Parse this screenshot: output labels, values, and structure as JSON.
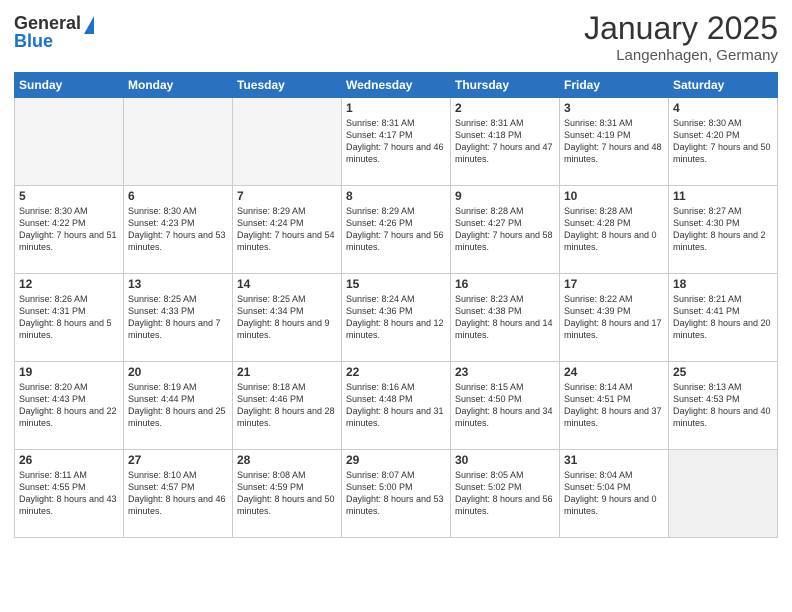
{
  "logo": {
    "general": "General",
    "blue": "Blue"
  },
  "header": {
    "month_year": "January 2025",
    "location": "Langenhagen, Germany"
  },
  "days_of_week": [
    "Sunday",
    "Monday",
    "Tuesday",
    "Wednesday",
    "Thursday",
    "Friday",
    "Saturday"
  ],
  "weeks": [
    [
      {
        "day": "",
        "info": ""
      },
      {
        "day": "",
        "info": ""
      },
      {
        "day": "",
        "info": ""
      },
      {
        "day": "1",
        "info": "Sunrise: 8:31 AM\nSunset: 4:17 PM\nDaylight: 7 hours and 46 minutes."
      },
      {
        "day": "2",
        "info": "Sunrise: 8:31 AM\nSunset: 4:18 PM\nDaylight: 7 hours and 47 minutes."
      },
      {
        "day": "3",
        "info": "Sunrise: 8:31 AM\nSunset: 4:19 PM\nDaylight: 7 hours and 48 minutes."
      },
      {
        "day": "4",
        "info": "Sunrise: 8:30 AM\nSunset: 4:20 PM\nDaylight: 7 hours and 50 minutes."
      }
    ],
    [
      {
        "day": "5",
        "info": "Sunrise: 8:30 AM\nSunset: 4:22 PM\nDaylight: 7 hours and 51 minutes."
      },
      {
        "day": "6",
        "info": "Sunrise: 8:30 AM\nSunset: 4:23 PM\nDaylight: 7 hours and 53 minutes."
      },
      {
        "day": "7",
        "info": "Sunrise: 8:29 AM\nSunset: 4:24 PM\nDaylight: 7 hours and 54 minutes."
      },
      {
        "day": "8",
        "info": "Sunrise: 8:29 AM\nSunset: 4:26 PM\nDaylight: 7 hours and 56 minutes."
      },
      {
        "day": "9",
        "info": "Sunrise: 8:28 AM\nSunset: 4:27 PM\nDaylight: 7 hours and 58 minutes."
      },
      {
        "day": "10",
        "info": "Sunrise: 8:28 AM\nSunset: 4:28 PM\nDaylight: 8 hours and 0 minutes."
      },
      {
        "day": "11",
        "info": "Sunrise: 8:27 AM\nSunset: 4:30 PM\nDaylight: 8 hours and 2 minutes."
      }
    ],
    [
      {
        "day": "12",
        "info": "Sunrise: 8:26 AM\nSunset: 4:31 PM\nDaylight: 8 hours and 5 minutes."
      },
      {
        "day": "13",
        "info": "Sunrise: 8:25 AM\nSunset: 4:33 PM\nDaylight: 8 hours and 7 minutes."
      },
      {
        "day": "14",
        "info": "Sunrise: 8:25 AM\nSunset: 4:34 PM\nDaylight: 8 hours and 9 minutes."
      },
      {
        "day": "15",
        "info": "Sunrise: 8:24 AM\nSunset: 4:36 PM\nDaylight: 8 hours and 12 minutes."
      },
      {
        "day": "16",
        "info": "Sunrise: 8:23 AM\nSunset: 4:38 PM\nDaylight: 8 hours and 14 minutes."
      },
      {
        "day": "17",
        "info": "Sunrise: 8:22 AM\nSunset: 4:39 PM\nDaylight: 8 hours and 17 minutes."
      },
      {
        "day": "18",
        "info": "Sunrise: 8:21 AM\nSunset: 4:41 PM\nDaylight: 8 hours and 20 minutes."
      }
    ],
    [
      {
        "day": "19",
        "info": "Sunrise: 8:20 AM\nSunset: 4:43 PM\nDaylight: 8 hours and 22 minutes."
      },
      {
        "day": "20",
        "info": "Sunrise: 8:19 AM\nSunset: 4:44 PM\nDaylight: 8 hours and 25 minutes."
      },
      {
        "day": "21",
        "info": "Sunrise: 8:18 AM\nSunset: 4:46 PM\nDaylight: 8 hours and 28 minutes."
      },
      {
        "day": "22",
        "info": "Sunrise: 8:16 AM\nSunset: 4:48 PM\nDaylight: 8 hours and 31 minutes."
      },
      {
        "day": "23",
        "info": "Sunrise: 8:15 AM\nSunset: 4:50 PM\nDaylight: 8 hours and 34 minutes."
      },
      {
        "day": "24",
        "info": "Sunrise: 8:14 AM\nSunset: 4:51 PM\nDaylight: 8 hours and 37 minutes."
      },
      {
        "day": "25",
        "info": "Sunrise: 8:13 AM\nSunset: 4:53 PM\nDaylight: 8 hours and 40 minutes."
      }
    ],
    [
      {
        "day": "26",
        "info": "Sunrise: 8:11 AM\nSunset: 4:55 PM\nDaylight: 8 hours and 43 minutes."
      },
      {
        "day": "27",
        "info": "Sunrise: 8:10 AM\nSunset: 4:57 PM\nDaylight: 8 hours and 46 minutes."
      },
      {
        "day": "28",
        "info": "Sunrise: 8:08 AM\nSunset: 4:59 PM\nDaylight: 8 hours and 50 minutes."
      },
      {
        "day": "29",
        "info": "Sunrise: 8:07 AM\nSunset: 5:00 PM\nDaylight: 8 hours and 53 minutes."
      },
      {
        "day": "30",
        "info": "Sunrise: 8:05 AM\nSunset: 5:02 PM\nDaylight: 8 hours and 56 minutes."
      },
      {
        "day": "31",
        "info": "Sunrise: 8:04 AM\nSunset: 5:04 PM\nDaylight: 9 hours and 0 minutes."
      },
      {
        "day": "",
        "info": ""
      }
    ]
  ],
  "empty_indices": {
    "week0": [
      0,
      1,
      2
    ],
    "week4": [
      6
    ]
  }
}
